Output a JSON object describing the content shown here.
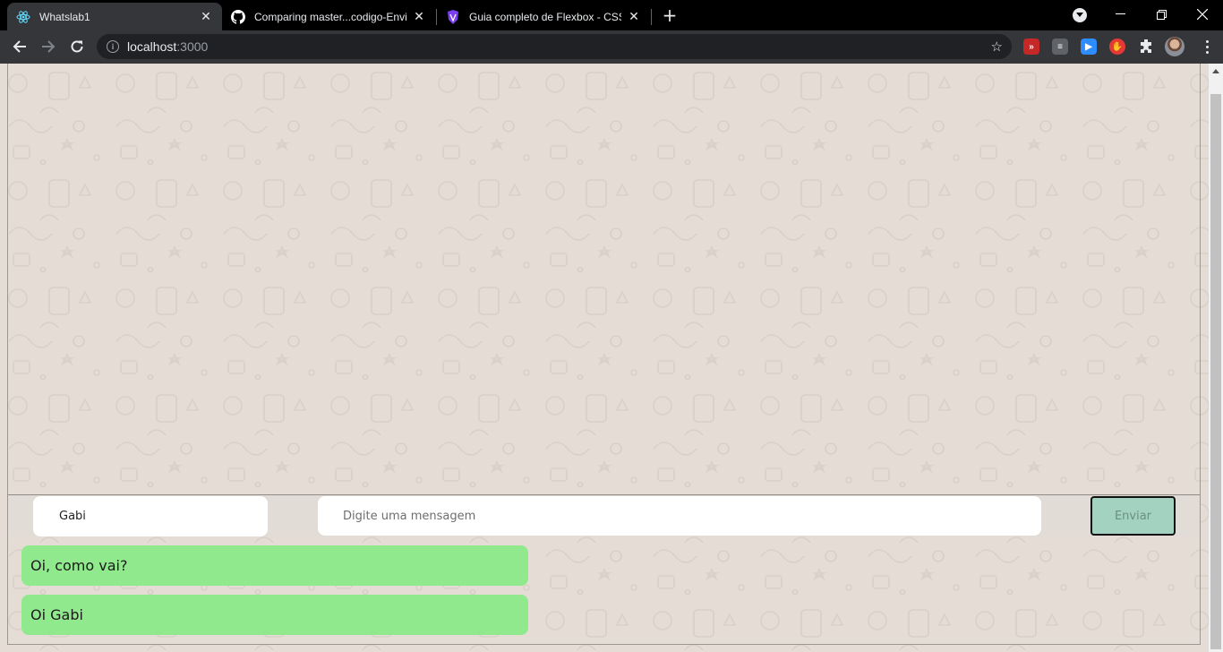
{
  "browser": {
    "tabs": [
      {
        "title": "Whatslab1",
        "icon": "react-icon",
        "active": true
      },
      {
        "title": "Comparing master...codigo-Envia",
        "icon": "github-icon",
        "active": false
      },
      {
        "title": "Guia completo de Flexbox - CSS",
        "icon": "origamid-icon",
        "active": false
      }
    ],
    "address": {
      "host": "localhost",
      "port": ":3000"
    },
    "extensions": [
      "red-extension-icon",
      "reader-icon",
      "zoom-icon",
      "adblock-icon",
      "puzzle-icon"
    ]
  },
  "chat": {
    "name_value": "Gabi",
    "message_placeholder": "Digite uma mensagem",
    "send_label": "Enviar",
    "messages": [
      {
        "text": "Oi, como vai?"
      },
      {
        "text": "Oi Gabi"
      }
    ]
  },
  "colors": {
    "background": "#e5ddd5",
    "bubble": "#90ea8d",
    "send_button": "#a3d3c0"
  }
}
